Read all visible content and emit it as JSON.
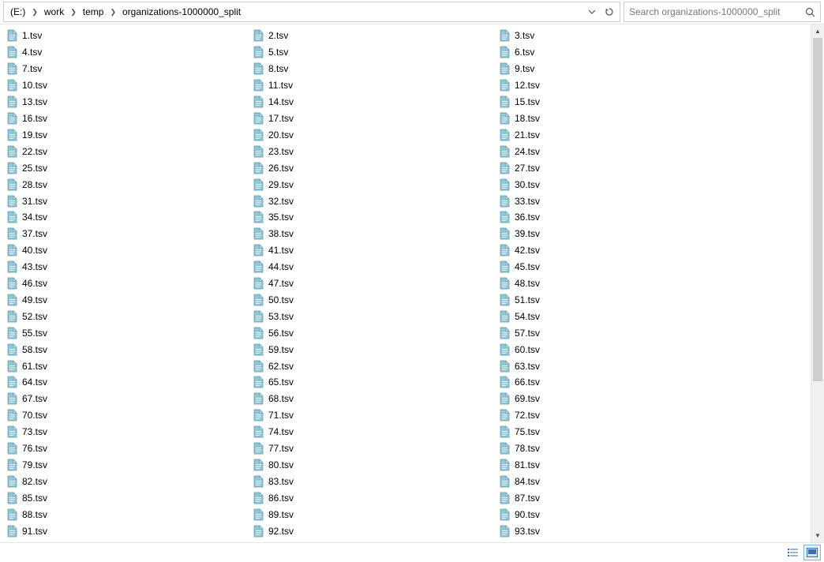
{
  "breadcrumb": {
    "root": "(E:)",
    "items": [
      "work",
      "temp",
      "organizations-1000000_split"
    ]
  },
  "search": {
    "placeholder": "Search organizations-1000000_split"
  },
  "files": {
    "col1": [
      "1.tsv",
      "4.tsv",
      "7.tsv",
      "10.tsv",
      "13.tsv",
      "16.tsv",
      "19.tsv",
      "22.tsv",
      "25.tsv",
      "28.tsv",
      "31.tsv",
      "34.tsv",
      "37.tsv",
      "40.tsv",
      "43.tsv",
      "46.tsv",
      "49.tsv",
      "52.tsv",
      "55.tsv",
      "58.tsv",
      "61.tsv",
      "64.tsv",
      "67.tsv",
      "70.tsv",
      "73.tsv",
      "76.tsv",
      "79.tsv",
      "82.tsv",
      "85.tsv",
      "88.tsv",
      "91.tsv"
    ],
    "col2": [
      "2.tsv",
      "5.tsv",
      "8.tsv",
      "11.tsv",
      "14.tsv",
      "17.tsv",
      "20.tsv",
      "23.tsv",
      "26.tsv",
      "29.tsv",
      "32.tsv",
      "35.tsv",
      "38.tsv",
      "41.tsv",
      "44.tsv",
      "47.tsv",
      "50.tsv",
      "53.tsv",
      "56.tsv",
      "59.tsv",
      "62.tsv",
      "65.tsv",
      "68.tsv",
      "71.tsv",
      "74.tsv",
      "77.tsv",
      "80.tsv",
      "83.tsv",
      "86.tsv",
      "89.tsv",
      "92.tsv"
    ],
    "col3": [
      "3.tsv",
      "6.tsv",
      "9.tsv",
      "12.tsv",
      "15.tsv",
      "18.tsv",
      "21.tsv",
      "24.tsv",
      "27.tsv",
      "30.tsv",
      "33.tsv",
      "36.tsv",
      "39.tsv",
      "42.tsv",
      "45.tsv",
      "48.tsv",
      "51.tsv",
      "54.tsv",
      "57.tsv",
      "60.tsv",
      "63.tsv",
      "66.tsv",
      "69.tsv",
      "72.tsv",
      "75.tsv",
      "78.tsv",
      "81.tsv",
      "84.tsv",
      "87.tsv",
      "90.tsv",
      "93.tsv"
    ]
  }
}
